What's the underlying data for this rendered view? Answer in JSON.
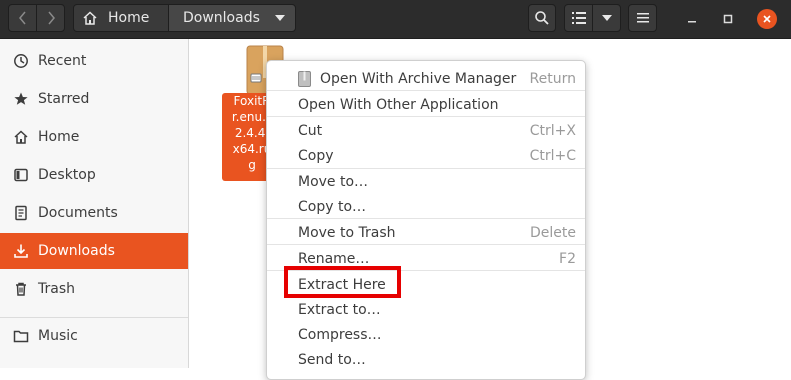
{
  "header": {
    "breadcrumb": {
      "home": "Home",
      "current": "Downloads"
    }
  },
  "sidebar": {
    "items": [
      {
        "label": "Recent",
        "icon": "clock-icon"
      },
      {
        "label": "Starred",
        "icon": "star-icon"
      },
      {
        "label": "Home",
        "icon": "home-icon"
      },
      {
        "label": "Desktop",
        "icon": "desktop-icon"
      },
      {
        "label": "Documents",
        "icon": "document-icon"
      },
      {
        "label": "Downloads",
        "icon": "download-icon",
        "active": true
      },
      {
        "label": "Trash",
        "icon": "trash-icon"
      },
      {
        "label": "Music",
        "icon": "folder-icon"
      }
    ]
  },
  "file": {
    "name_lines": [
      "FoxitR",
      "r.enu.s",
      "2.4.4.",
      "x64.ru",
      "g"
    ],
    "icon": "archive-icon"
  },
  "context_menu": {
    "items": [
      {
        "label": "Open With Archive Manager",
        "accel": "Return",
        "icon": "archive-manager-icon"
      },
      {
        "label": "Open With Other Application",
        "accel": ""
      },
      {
        "label": "Cut",
        "accel": "Ctrl+X"
      },
      {
        "label": "Copy",
        "accel": "Ctrl+C"
      },
      {
        "label": "Move to…",
        "accel": ""
      },
      {
        "label": "Copy to…",
        "accel": ""
      },
      {
        "label": "Move to Trash",
        "accel": "Delete"
      },
      {
        "label": "Rename…",
        "accel": "F2"
      },
      {
        "label": "Extract Here",
        "accel": "",
        "highlighted": true
      },
      {
        "label": "Extract to…",
        "accel": ""
      },
      {
        "label": "Compress…",
        "accel": ""
      },
      {
        "label": "Send to…",
        "accel": ""
      }
    ]
  },
  "colors": {
    "accent": "#e95420",
    "highlight_box": "#e60000",
    "headerbar": "#2c2c2c"
  }
}
